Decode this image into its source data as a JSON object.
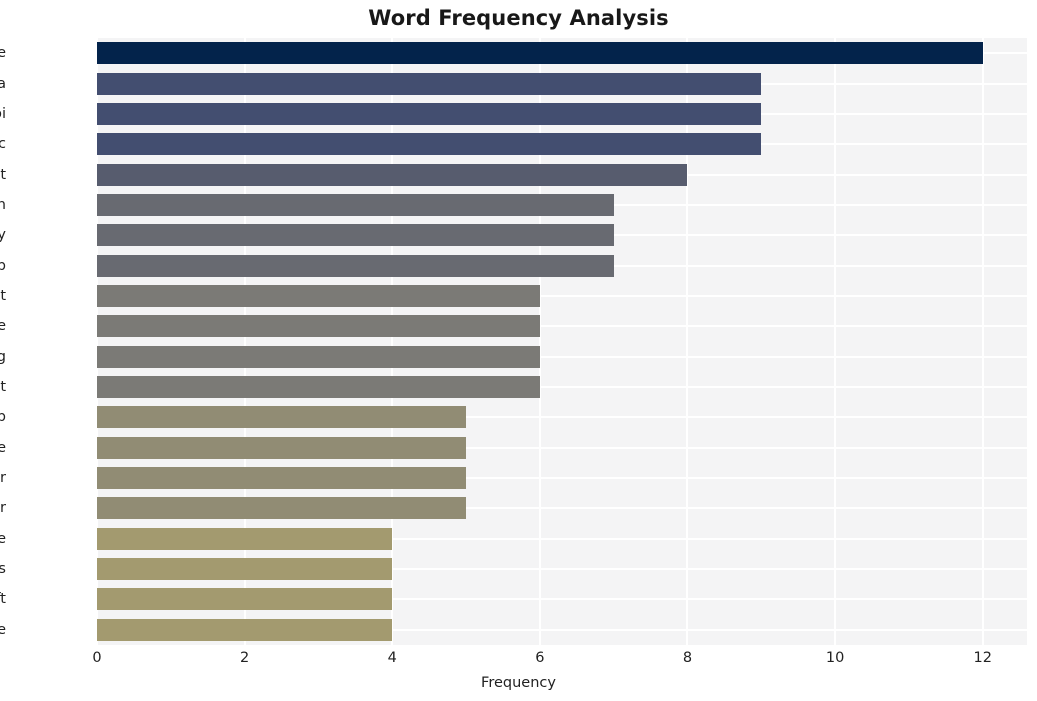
{
  "chart_data": {
    "type": "bar",
    "orientation": "horizontal",
    "title": "Word Frequency Analysis",
    "xlabel": "Frequency",
    "ylabel": "",
    "xlim": [
      0,
      12.6
    ],
    "xticks": [
      0,
      2,
      4,
      6,
      8,
      10,
      12
    ],
    "xtick_labels": [
      "0",
      "2",
      "4",
      "6",
      "8",
      "10",
      "12"
    ],
    "grid": true,
    "legend": "none",
    "plot_background": "#f4f4f5",
    "gridline_color": "#ffffff",
    "categories": [
      "service",
      "data",
      "api",
      "public",
      "encrypt",
      "encryption",
      "body",
      "step",
      "net",
      "core",
      "string",
      "decrypt",
      "web",
      "create",
      "protector",
      "header",
      "ensure",
      "process",
      "microsoft",
      "aspnetcore"
    ],
    "values": [
      12,
      9,
      9,
      9,
      8,
      7,
      7,
      7,
      6,
      6,
      6,
      6,
      5,
      5,
      5,
      5,
      4,
      4,
      4,
      4
    ],
    "bar_colors": [
      "#03234b",
      "#434e70",
      "#434e70",
      "#434e70",
      "#575c6e",
      "#686a71",
      "#686a71",
      "#686a71",
      "#7b7a76",
      "#7b7a76",
      "#7b7a76",
      "#7b7a76",
      "#918c74",
      "#918c74",
      "#918c74",
      "#918c74",
      "#a39a6f",
      "#a39a6f",
      "#a39a6f",
      "#a39a6f"
    ]
  },
  "title": {
    "text": "Word Frequency Analysis"
  },
  "axes": {
    "x_label": "Frequency"
  }
}
